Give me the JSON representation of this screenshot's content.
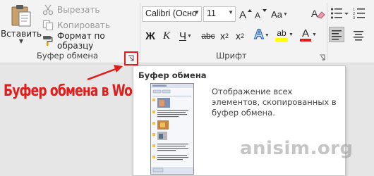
{
  "clipboard_group": {
    "paste_label": "Вставить",
    "cut_label": "Вырезать",
    "copy_label": "Копировать",
    "format_painter_label": "Формат по образцу",
    "group_label": "Буфер обмена"
  },
  "font_group": {
    "font_name": "Calibri (Осно",
    "font_size": "11",
    "bold": "Ж",
    "italic": "К",
    "underline": "Ч",
    "strikethrough": "abc",
    "subscript": "x",
    "subscript_mark": "2",
    "superscript": "x",
    "superscript_mark": "2",
    "case_label": "Aa",
    "text_effects": "A",
    "highlight": "ab",
    "font_color": "A",
    "group_label": "Шрифт"
  },
  "tooltip": {
    "title": "Буфер обмена",
    "description": "Отображение всех элементов, скопированных в буфер обмена."
  },
  "annotation": {
    "text": "Буфер обмена в Word",
    "color": "#e41b1b"
  },
  "watermark": "anisim.org",
  "colors": {
    "ribbon_bg": "#f3f3f3",
    "highlight_yellow": "#ffff00",
    "font_red": "#e41b1b"
  }
}
